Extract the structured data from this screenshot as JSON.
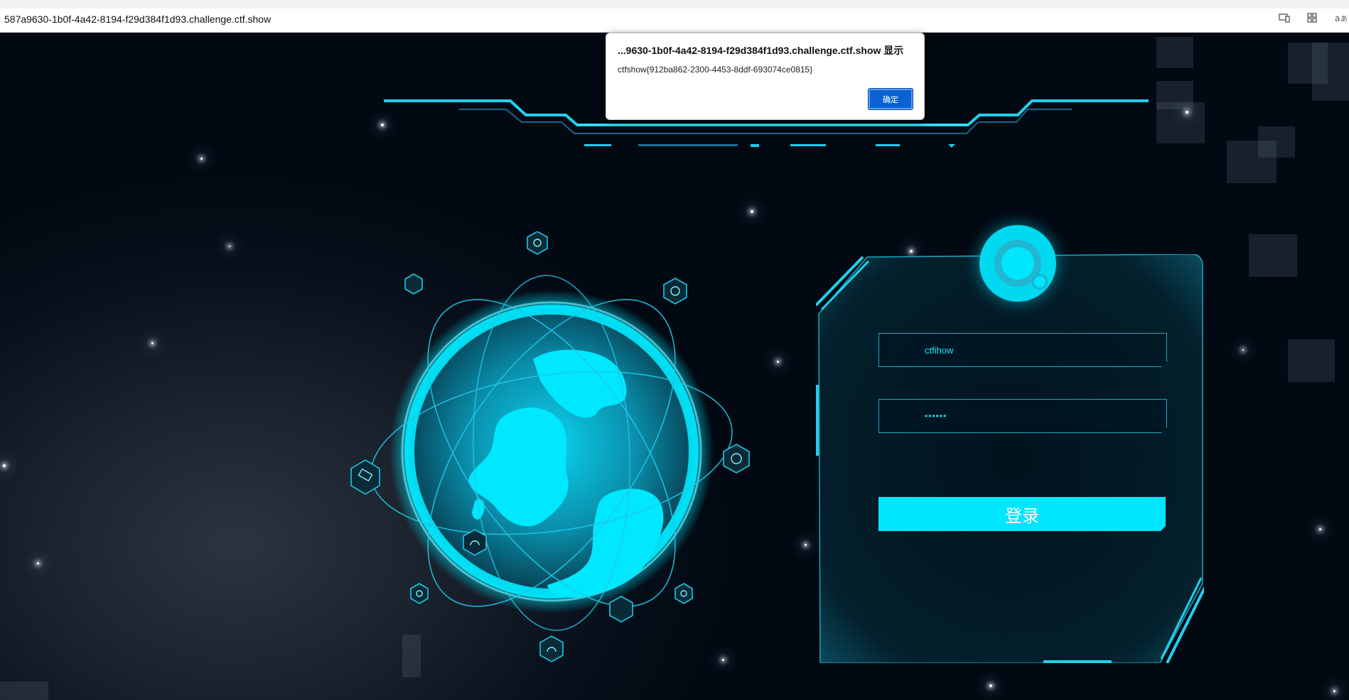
{
  "browser": {
    "address_url": "587a9630-1b0f-4a42-8194-f29d384f1d93.challenge.ctf.show",
    "toolbar_icons": [
      "device-icon",
      "apps-icon",
      "translate-icon"
    ]
  },
  "alert": {
    "title": "...9630-1b0f-4a42-8194-f29d384f1d93.challenge.ctf.show 显示",
    "message": "ctfshow{912ba862-2300-4453-8ddf-693074ce0815}",
    "ok_label": "确定"
  },
  "login": {
    "username_value": "ctfihow",
    "password_mask": "••••••",
    "submit_label": "登录"
  },
  "colors": {
    "accent": "#00e6ff",
    "background": "#020b16",
    "dialog_button": "#0a62d4"
  }
}
